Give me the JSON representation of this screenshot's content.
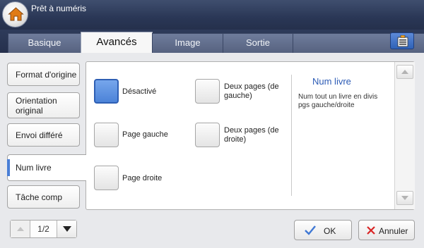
{
  "header": {
    "title": "Prêt à numéris"
  },
  "tabs": [
    {
      "label": "Basique",
      "active": false
    },
    {
      "label": "Avancés",
      "active": true
    },
    {
      "label": "Image",
      "active": false
    },
    {
      "label": "Sortie",
      "active": false
    }
  ],
  "sidebar": {
    "items": [
      {
        "label": "Format d'origine"
      },
      {
        "label": "Orientation original"
      },
      {
        "label": "Envoi différé"
      },
      {
        "label": "Num livre",
        "active": true
      },
      {
        "label": "Tâche comp"
      }
    ]
  },
  "options": [
    {
      "label": "Désactivé",
      "selected": true
    },
    {
      "label": "Page gauche",
      "selected": false
    },
    {
      "label": "Page droite",
      "selected": false
    },
    {
      "label": "Deux pages (de gauche)",
      "selected": false
    },
    {
      "label": "Deux pages (de droite)",
      "selected": false
    }
  ],
  "info": {
    "title": "Num livre",
    "description": "Num tout un livre en divis pgs gauche/droite"
  },
  "pager": {
    "text": "1/2"
  },
  "buttons": {
    "ok": "OK",
    "cancel": "Annuler"
  },
  "colors": {
    "accent": "#4a7fd6",
    "title_bar": "#2a3756",
    "selected": "#5c8fe0"
  },
  "icons": [
    "home-icon",
    "settings-list-icon",
    "scroll-up-icon",
    "scroll-down-icon",
    "page-up-icon",
    "page-down-icon",
    "checkmark-icon",
    "x-icon"
  ]
}
